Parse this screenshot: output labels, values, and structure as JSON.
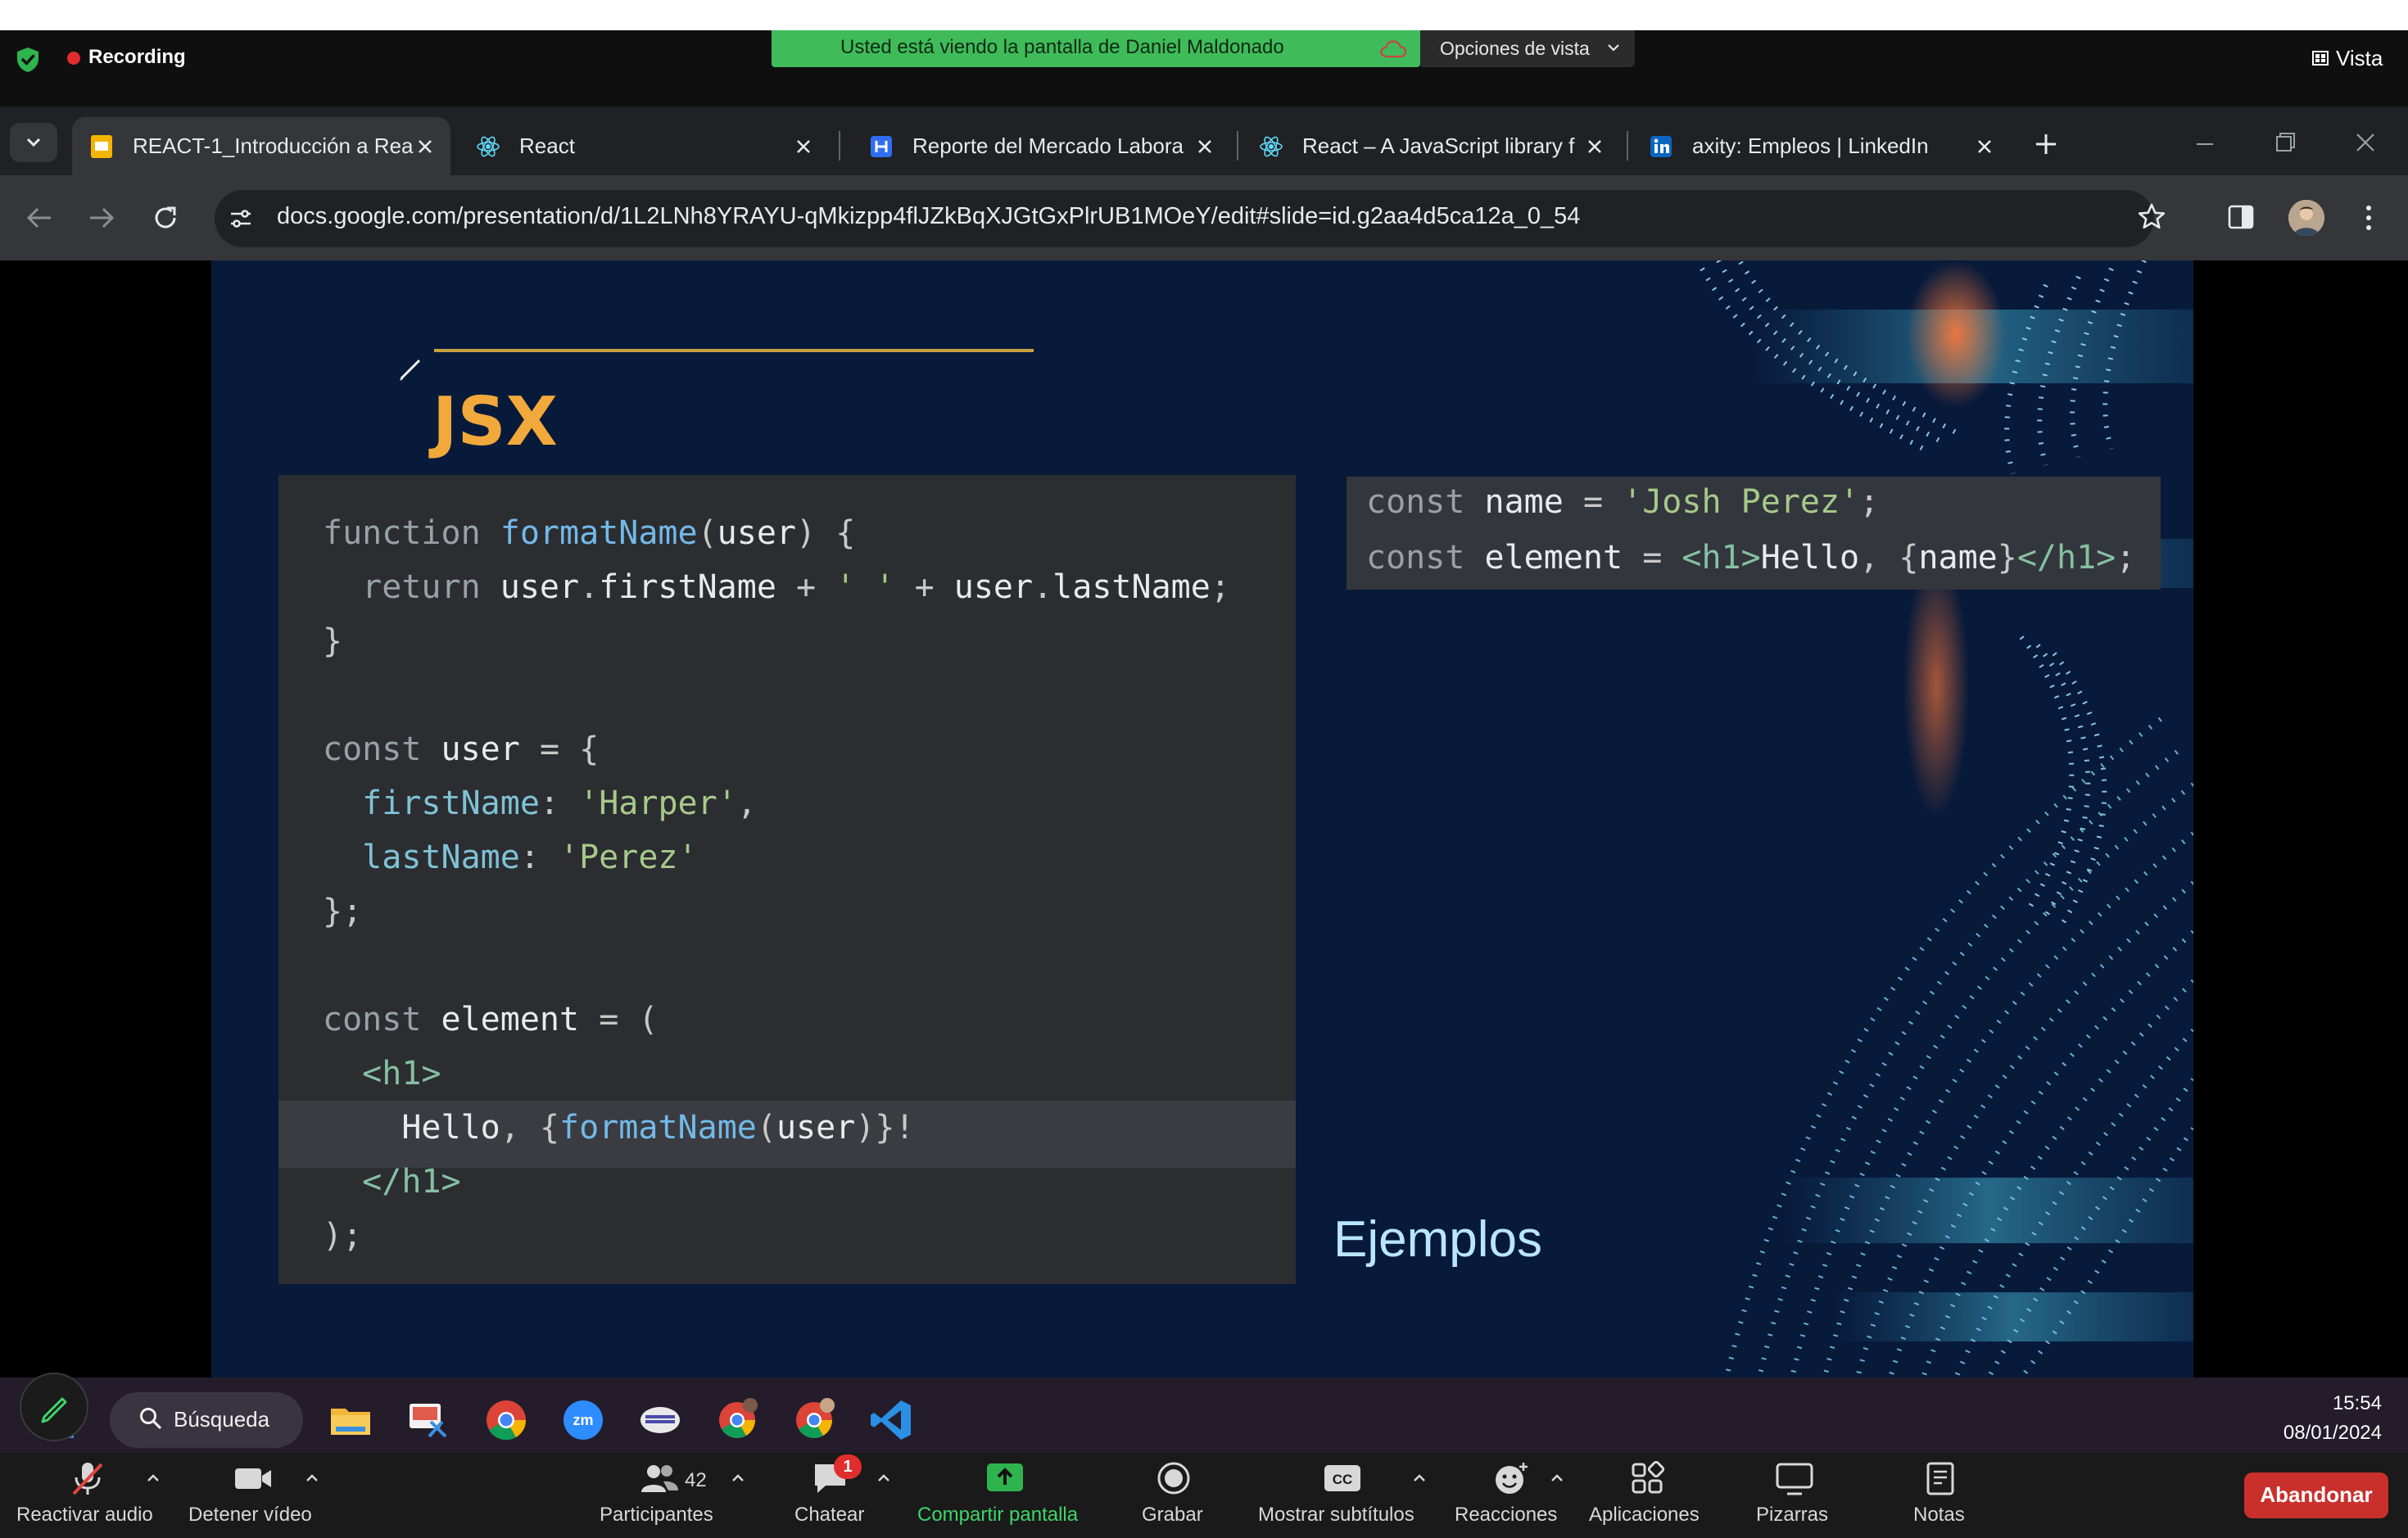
{
  "zoom_top": {
    "recording_label": "Recording",
    "share_banner": "Usted está viendo la pantalla de Daniel Maldonado",
    "view_options": "Opciones de vista",
    "vista_label": "Vista"
  },
  "browser": {
    "tabs": [
      {
        "title": "REACT-1_Introducción a Rea",
        "active": true
      },
      {
        "title": "React",
        "active": false
      },
      {
        "title": "Reporte del Mercado Labora",
        "active": false
      },
      {
        "title": "React – A JavaScript library f",
        "active": false
      },
      {
        "title": "axity: Empleos | LinkedIn",
        "active": false
      }
    ],
    "url": "docs.google.com/presentation/d/1L2LNh8YRAYU-qMkizpp4flJZkBqXJGtGxPlrUB1MOeY/edit#slide=id.g2aa4d5ca12a_0_54"
  },
  "slide": {
    "title": "JSX",
    "caption": "Ejemplos",
    "code_left": [
      "function formatName(user) {",
      "  return user.firstName + ' ' + user.lastName;",
      "}",
      "",
      "const user = {",
      "  firstName: 'Harper',",
      "  lastName: 'Perez'",
      "};",
      "",
      "const element = (",
      "  <h1>",
      "    Hello, {formatName(user)}!",
      "  </h1>",
      ");"
    ],
    "code_right": [
      "const name = 'Josh Perez';",
      "const element = <h1>Hello, {name}</h1>;"
    ]
  },
  "taskbar": {
    "search_label": "Búsqueda",
    "time": "15:54",
    "date": "08/01/2024"
  },
  "zoom_bottom": {
    "mute": "Reactivar audio",
    "video": "Detener vídeo",
    "participants": "Participantes",
    "participants_count": "42",
    "chat": "Chatear",
    "chat_badge": "1",
    "share": "Compartir pantalla",
    "record": "Grabar",
    "captions": "Mostrar subtítulos",
    "reactions": "Reacciones",
    "apps": "Aplicaciones",
    "whiteboards": "Pizarras",
    "notes": "Notas",
    "leave": "Abandonar"
  },
  "colors": {
    "share_green": "#3fbb5a",
    "slide_bg": "#081a3a",
    "title_accent": "#f2a93b",
    "leave_red": "#c9302c"
  }
}
